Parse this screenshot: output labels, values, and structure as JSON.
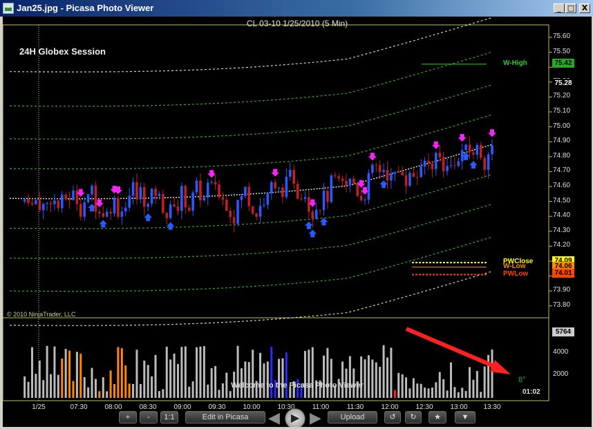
{
  "window": {
    "title": "Jan25.jpg - Picasa Photo Viewer",
    "controls": {
      "minimize": "_",
      "maximize": "□",
      "close": "X"
    }
  },
  "chart": {
    "title": "CL 03-10  1/25/2010 (5 Min)",
    "session_label": "24H Globex Session",
    "copyright": "© 2010 NinjaTrader, LLC",
    "y_ticks": [
      "75.60",
      "75.50",
      "75.40",
      "75.30",
      "75.20",
      "75.10",
      "75.00",
      "74.90",
      "74.80",
      "74.70",
      "74.60",
      "74.50",
      "74.40",
      "74.30",
      "74.20",
      "74.10",
      "74.00",
      "73.90",
      "73.80"
    ],
    "x_ticks": [
      "1/25",
      "07:30",
      "08:00",
      "08:30",
      "09:00",
      "09:30",
      "10:00",
      "10:30",
      "11:00",
      "11:30",
      "12:00",
      "12:30",
      "13:00",
      "13:30"
    ],
    "volume_ticks": [
      "4000",
      "2000"
    ],
    "price_tags": [
      {
        "label": "75.42",
        "bg": "#22aa22",
        "fg": "#000000"
      },
      {
        "label": "75.28",
        "bg": "#000000",
        "fg": "#ffffff"
      },
      {
        "label": "74.09",
        "bg": "#ffff00",
        "fg": "#000000"
      },
      {
        "label": "74.06",
        "bg": "#ff8800",
        "fg": "#000000"
      },
      {
        "label": "74.01",
        "bg": "#ff4400",
        "fg": "#000000"
      },
      {
        "label": "5764",
        "bg": "#cccccc",
        "fg": "#000000"
      }
    ],
    "level_labels": {
      "w_high": "W-High",
      "pw_close": "PWClose",
      "w_low": "W-Low",
      "pw_low": "PWLow"
    },
    "volume_clock": "01:02",
    "indicator_value": "8°",
    "colors": {
      "up_candle": "#2a5aff",
      "down_candle": "#c02020",
      "band": "#33aa33",
      "outer_band": "#d8d8a0",
      "midline": "#e0e0e0",
      "arrow": "#ff22ff",
      "annotation": "#ff2020"
    }
  },
  "viewer": {
    "overlay_text": "Welcome to the Picasa Photo Viewer",
    "buttons": {
      "zoom_in": "+",
      "zoom_out": "-",
      "actual_size": "1:1",
      "edit": "Edit in Picasa",
      "upload": "Upload"
    },
    "icons": {
      "prev": "◀",
      "play": "▶",
      "next": "▶",
      "rotate_left": "↺",
      "rotate_right": "↻",
      "star": "★",
      "more": "▼"
    }
  }
}
